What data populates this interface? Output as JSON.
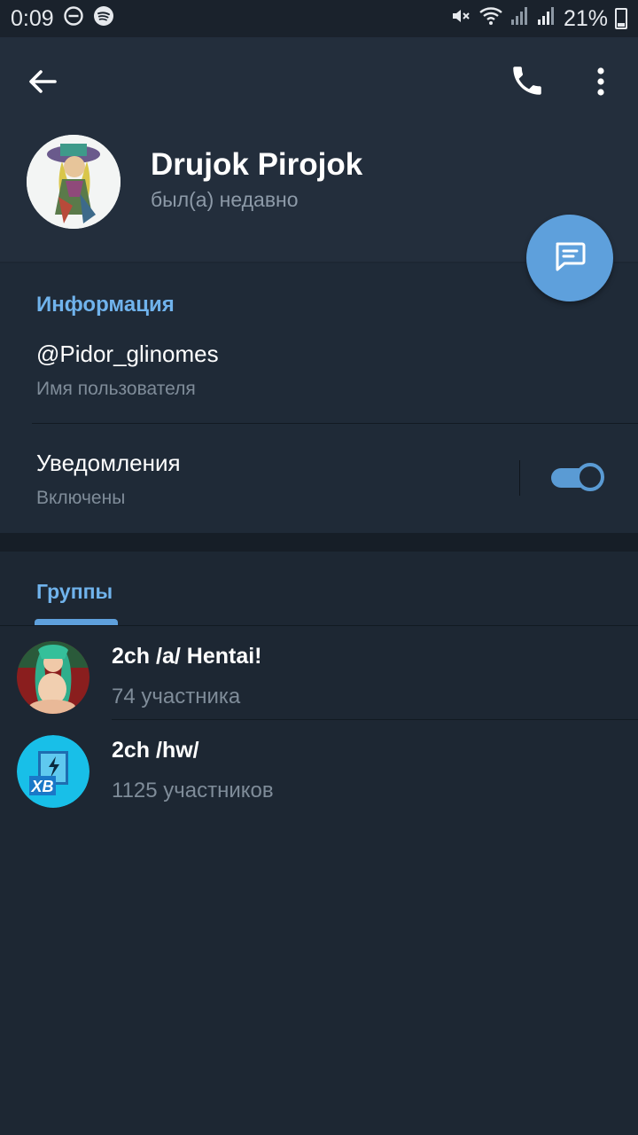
{
  "status_bar": {
    "time": "0:09",
    "battery": "21%",
    "icons": [
      "do-not-disturb-icon",
      "spotify-icon",
      "mute-icon",
      "wifi-icon",
      "signal-icon",
      "signal-icon",
      "battery-icon"
    ]
  },
  "header": {
    "name": "Drujok Pirojok",
    "status": "был(а) недавно",
    "icons": [
      "back-arrow-icon",
      "phone-icon",
      "more-vertical-icon",
      "message-icon"
    ]
  },
  "info": {
    "title": "Информация",
    "username": "@Pidor_glinomes",
    "username_label": "Имя пользователя",
    "notifications_label": "Уведомления",
    "notifications_state": "Включены",
    "notifications_on": true
  },
  "groups": {
    "tab_label": "Группы",
    "items": [
      {
        "name": "2ch /a/ Hentai!",
        "members": "74 участника"
      },
      {
        "name": "2ch /hw/",
        "members": "1125 участников",
        "avatar_text": "XB"
      }
    ]
  },
  "colors": {
    "accent": "#70b3ec",
    "fab": "#5ea0dc",
    "header_bg": "#232e3c",
    "page_bg": "#1d2733"
  }
}
